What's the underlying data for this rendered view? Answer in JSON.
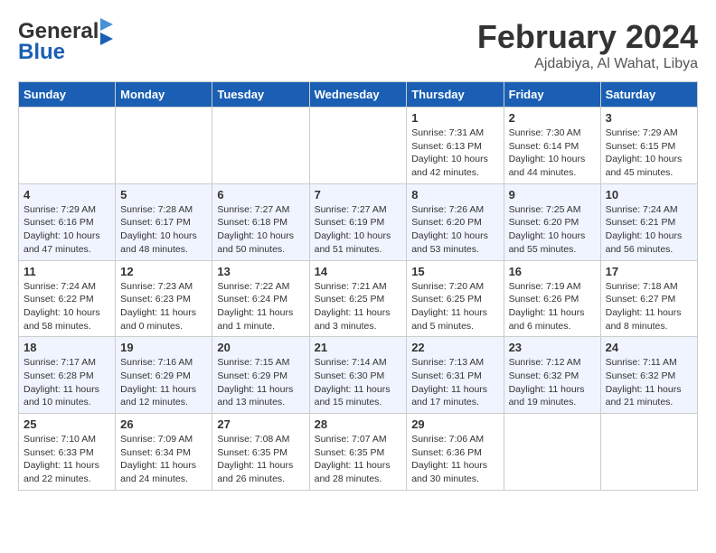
{
  "logo": {
    "text_general": "General",
    "text_blue": "Blue"
  },
  "header": {
    "month": "February 2024",
    "location": "Ajdabiya, Al Wahat, Libya"
  },
  "weekdays": [
    "Sunday",
    "Monday",
    "Tuesday",
    "Wednesday",
    "Thursday",
    "Friday",
    "Saturday"
  ],
  "weeks": [
    [
      {
        "day": "",
        "info": ""
      },
      {
        "day": "",
        "info": ""
      },
      {
        "day": "",
        "info": ""
      },
      {
        "day": "",
        "info": ""
      },
      {
        "day": "1",
        "info": "Sunrise: 7:31 AM\nSunset: 6:13 PM\nDaylight: 10 hours\nand 42 minutes."
      },
      {
        "day": "2",
        "info": "Sunrise: 7:30 AM\nSunset: 6:14 PM\nDaylight: 10 hours\nand 44 minutes."
      },
      {
        "day": "3",
        "info": "Sunrise: 7:29 AM\nSunset: 6:15 PM\nDaylight: 10 hours\nand 45 minutes."
      }
    ],
    [
      {
        "day": "4",
        "info": "Sunrise: 7:29 AM\nSunset: 6:16 PM\nDaylight: 10 hours\nand 47 minutes."
      },
      {
        "day": "5",
        "info": "Sunrise: 7:28 AM\nSunset: 6:17 PM\nDaylight: 10 hours\nand 48 minutes."
      },
      {
        "day": "6",
        "info": "Sunrise: 7:27 AM\nSunset: 6:18 PM\nDaylight: 10 hours\nand 50 minutes."
      },
      {
        "day": "7",
        "info": "Sunrise: 7:27 AM\nSunset: 6:19 PM\nDaylight: 10 hours\nand 51 minutes."
      },
      {
        "day": "8",
        "info": "Sunrise: 7:26 AM\nSunset: 6:20 PM\nDaylight: 10 hours\nand 53 minutes."
      },
      {
        "day": "9",
        "info": "Sunrise: 7:25 AM\nSunset: 6:20 PM\nDaylight: 10 hours\nand 55 minutes."
      },
      {
        "day": "10",
        "info": "Sunrise: 7:24 AM\nSunset: 6:21 PM\nDaylight: 10 hours\nand 56 minutes."
      }
    ],
    [
      {
        "day": "11",
        "info": "Sunrise: 7:24 AM\nSunset: 6:22 PM\nDaylight: 10 hours\nand 58 minutes."
      },
      {
        "day": "12",
        "info": "Sunrise: 7:23 AM\nSunset: 6:23 PM\nDaylight: 11 hours\nand 0 minutes."
      },
      {
        "day": "13",
        "info": "Sunrise: 7:22 AM\nSunset: 6:24 PM\nDaylight: 11 hours\nand 1 minute."
      },
      {
        "day": "14",
        "info": "Sunrise: 7:21 AM\nSunset: 6:25 PM\nDaylight: 11 hours\nand 3 minutes."
      },
      {
        "day": "15",
        "info": "Sunrise: 7:20 AM\nSunset: 6:25 PM\nDaylight: 11 hours\nand 5 minutes."
      },
      {
        "day": "16",
        "info": "Sunrise: 7:19 AM\nSunset: 6:26 PM\nDaylight: 11 hours\nand 6 minutes."
      },
      {
        "day": "17",
        "info": "Sunrise: 7:18 AM\nSunset: 6:27 PM\nDaylight: 11 hours\nand 8 minutes."
      }
    ],
    [
      {
        "day": "18",
        "info": "Sunrise: 7:17 AM\nSunset: 6:28 PM\nDaylight: 11 hours\nand 10 minutes."
      },
      {
        "day": "19",
        "info": "Sunrise: 7:16 AM\nSunset: 6:29 PM\nDaylight: 11 hours\nand 12 minutes."
      },
      {
        "day": "20",
        "info": "Sunrise: 7:15 AM\nSunset: 6:29 PM\nDaylight: 11 hours\nand 13 minutes."
      },
      {
        "day": "21",
        "info": "Sunrise: 7:14 AM\nSunset: 6:30 PM\nDaylight: 11 hours\nand 15 minutes."
      },
      {
        "day": "22",
        "info": "Sunrise: 7:13 AM\nSunset: 6:31 PM\nDaylight: 11 hours\nand 17 minutes."
      },
      {
        "day": "23",
        "info": "Sunrise: 7:12 AM\nSunset: 6:32 PM\nDaylight: 11 hours\nand 19 minutes."
      },
      {
        "day": "24",
        "info": "Sunrise: 7:11 AM\nSunset: 6:32 PM\nDaylight: 11 hours\nand 21 minutes."
      }
    ],
    [
      {
        "day": "25",
        "info": "Sunrise: 7:10 AM\nSunset: 6:33 PM\nDaylight: 11 hours\nand 22 minutes."
      },
      {
        "day": "26",
        "info": "Sunrise: 7:09 AM\nSunset: 6:34 PM\nDaylight: 11 hours\nand 24 minutes."
      },
      {
        "day": "27",
        "info": "Sunrise: 7:08 AM\nSunset: 6:35 PM\nDaylight: 11 hours\nand 26 minutes."
      },
      {
        "day": "28",
        "info": "Sunrise: 7:07 AM\nSunset: 6:35 PM\nDaylight: 11 hours\nand 28 minutes."
      },
      {
        "day": "29",
        "info": "Sunrise: 7:06 AM\nSunset: 6:36 PM\nDaylight: 11 hours\nand 30 minutes."
      },
      {
        "day": "",
        "info": ""
      },
      {
        "day": "",
        "info": ""
      }
    ]
  ]
}
